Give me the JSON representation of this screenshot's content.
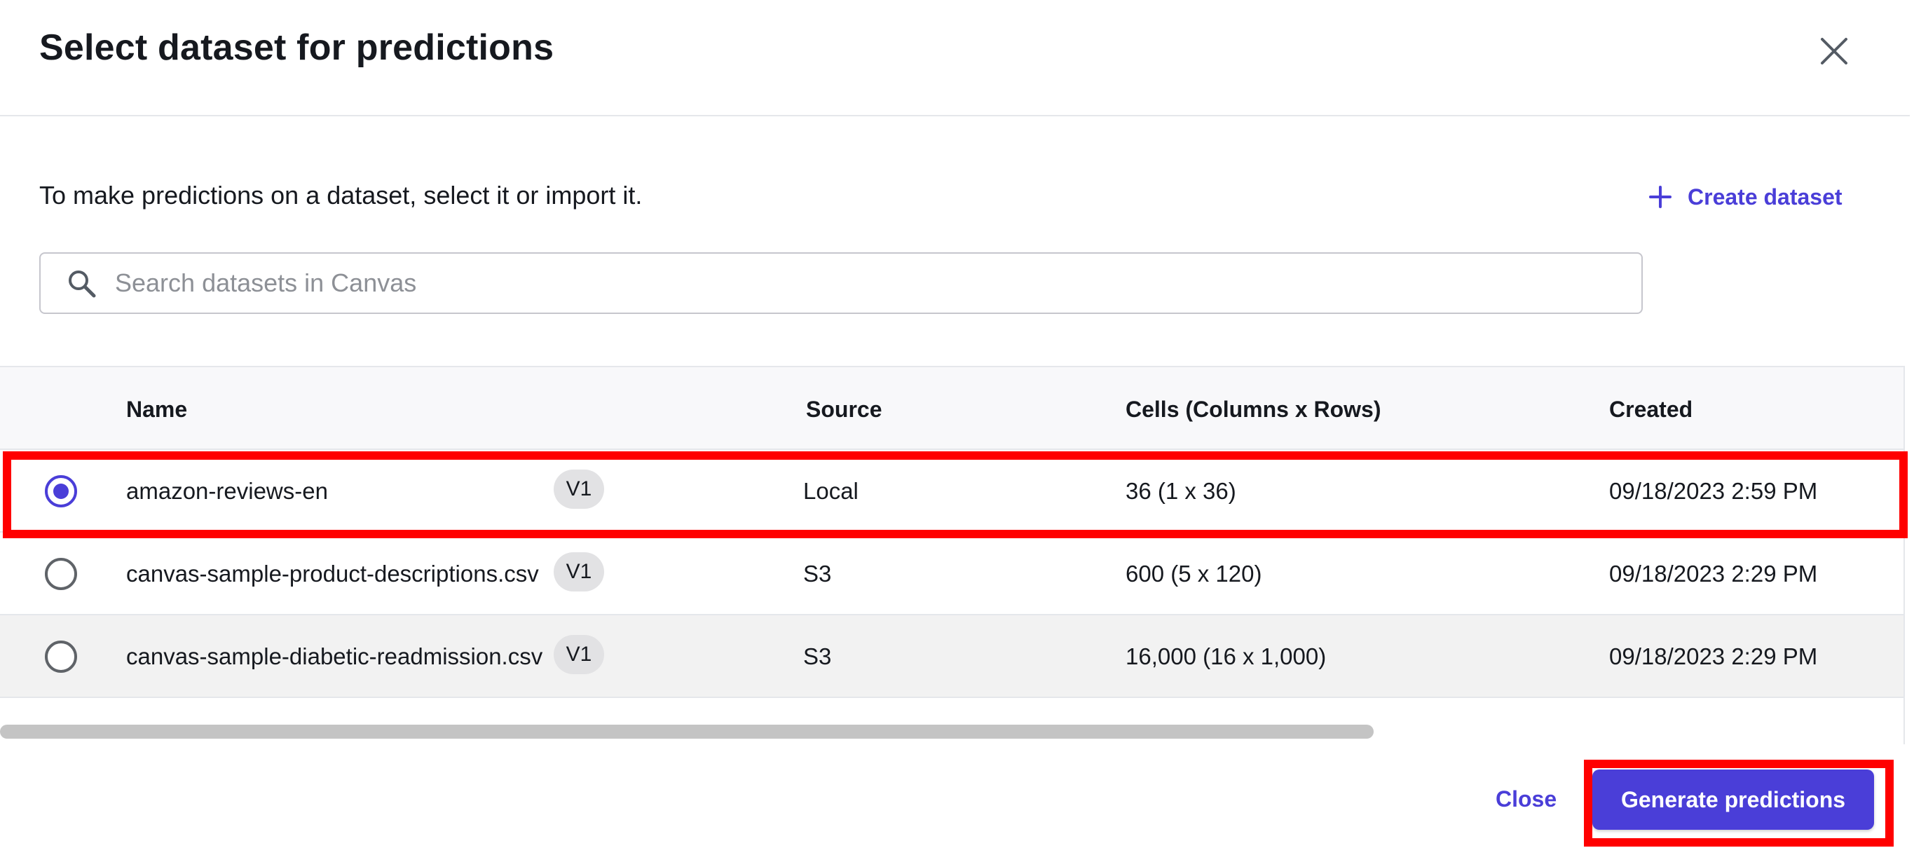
{
  "dialog": {
    "title": "Select dataset for predictions",
    "close_icon": "close-icon"
  },
  "intro_text": "To make predictions on a dataset, select it or import it.",
  "create_dataset": {
    "label": "Create dataset",
    "icon": "plus-icon"
  },
  "search": {
    "placeholder": "Search datasets in Canvas",
    "value": "",
    "icon": "search-icon"
  },
  "table": {
    "columns": [
      "Name",
      "Source",
      "Cells (Columns x Rows)",
      "Created"
    ],
    "rows": [
      {
        "name": "amazon-reviews-en",
        "version": "V1",
        "source": "Local",
        "cells": "36 (1 x 36)",
        "created": "09/18/2023 2:59 PM",
        "selected": true
      },
      {
        "name": "canvas-sample-product-descriptions.csv",
        "version": "V1",
        "source": "S3",
        "cells": "600 (5 x 120)",
        "created": "09/18/2023 2:29 PM",
        "selected": false
      },
      {
        "name": "canvas-sample-diabetic-readmission.csv",
        "version": "V1",
        "source": "S3",
        "cells": "16,000 (16 x 1,000)",
        "created": "09/18/2023 2:29 PM",
        "selected": false
      }
    ]
  },
  "footer": {
    "close_label": "Close",
    "generate_label": "Generate predictions"
  },
  "colors": {
    "accent": "#4a3ed8",
    "highlight": "#ff0000"
  }
}
